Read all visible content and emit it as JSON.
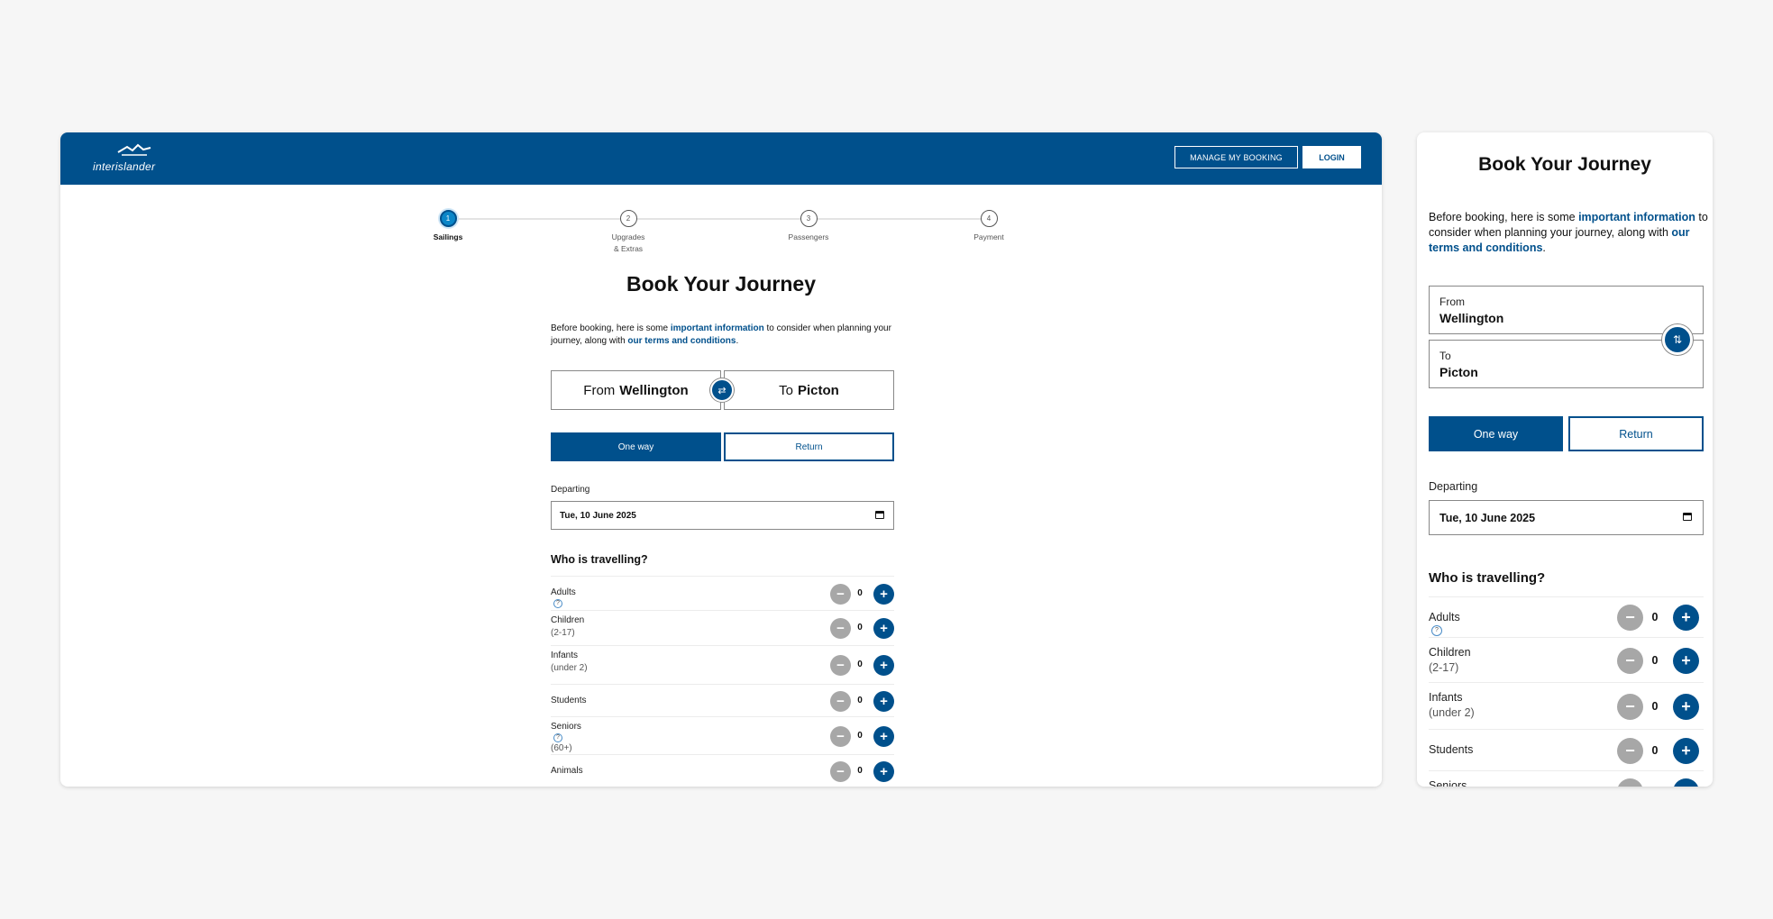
{
  "header": {
    "logo_text": "interislander",
    "manage_booking_label": "MANAGE MY BOOKING",
    "login_label": "LOGIN"
  },
  "steps": [
    {
      "number": "1",
      "label": "Sailings",
      "active": true
    },
    {
      "number": "2",
      "label": "Upgrades\n& Extras",
      "label_line1": "Upgrades",
      "label_line2": "& Extras"
    },
    {
      "number": "3",
      "label": "Passengers"
    },
    {
      "number": "4",
      "label": "Payment"
    }
  ],
  "title": "Book Your Journey",
  "intro": {
    "prefix": "Before booking, here is some ",
    "important_link": "important information",
    "middle": " to consider when planning your journey, along with ",
    "terms_link": "our terms and conditions",
    "suffix": "."
  },
  "route": {
    "from_prefix": "From",
    "from_value": "Wellington",
    "to_prefix": "To",
    "to_value": "Picton"
  },
  "trip_type": {
    "one_way_label": "One way",
    "return_label": "Return",
    "selected": "One way"
  },
  "departing": {
    "label": "Departing",
    "value": "Tue, 10 June 2025"
  },
  "who_title": "Who is travelling?",
  "passengers": [
    {
      "label": "Adults",
      "sub": "",
      "count": "0",
      "info": true
    },
    {
      "label": "Children",
      "sub": "(2-17)",
      "count": "0",
      "info": false
    },
    {
      "label": "Infants",
      "sub": "(under 2)",
      "count": "0",
      "info": false
    },
    {
      "label": "Students",
      "sub": "",
      "count": "0",
      "info": false
    },
    {
      "label": "Seniors",
      "sub": "(60+)",
      "count": "0",
      "info": true
    },
    {
      "label": "Animals",
      "sub": "",
      "count": "0",
      "info": false
    }
  ],
  "icons": {
    "swap": "swap-arrows-icon",
    "calendar": "calendar-icon",
    "info": "info-circle-icon",
    "minus": "minus-icon",
    "plus": "plus-icon"
  },
  "colors": {
    "brand": "#00508c",
    "disabled": "#a7a7a7"
  }
}
